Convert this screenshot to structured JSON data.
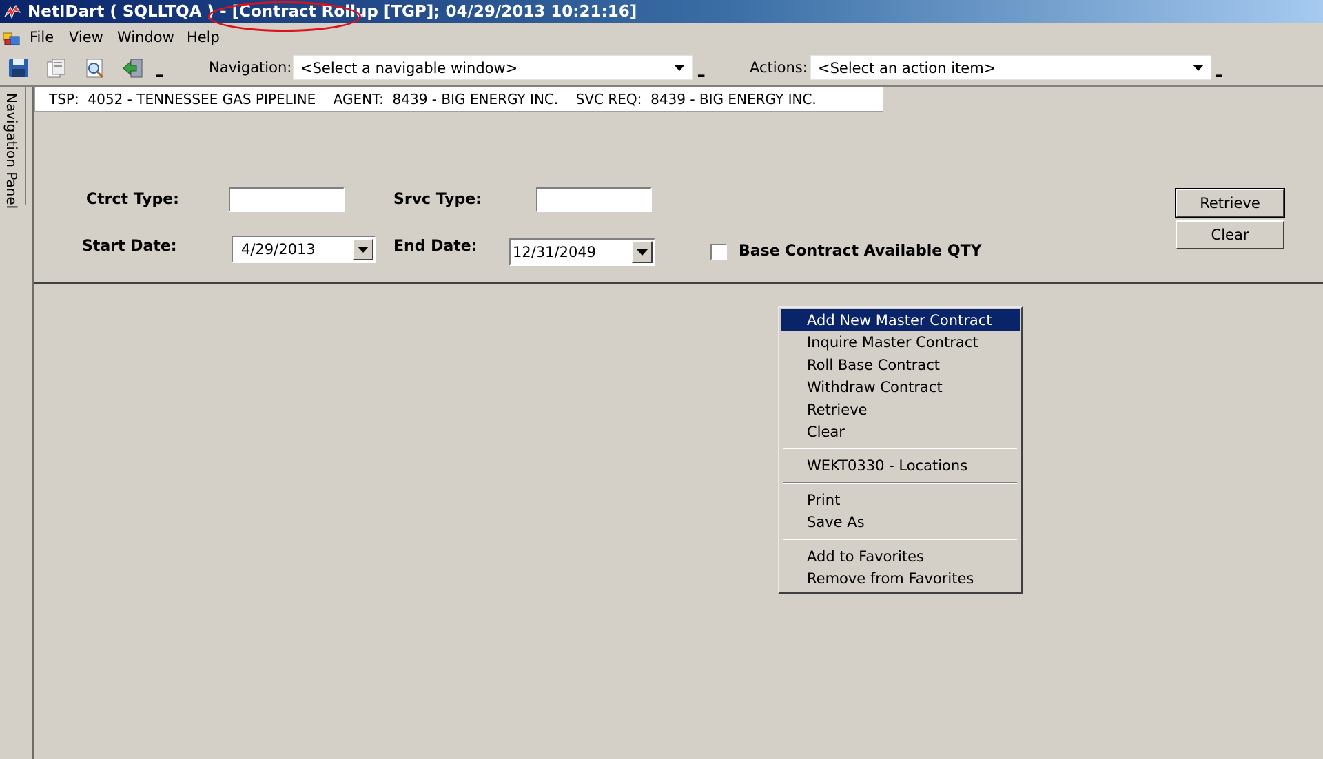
{
  "window": {
    "title": "NetIDart ( SQLLTQA ) - [Contract Rollup [TGP]; 04/29/2013 10:21:16]",
    "app_icon": "netidart-app-icon",
    "annotation_color": "#e0101b"
  },
  "menubar": {
    "items": [
      "File",
      "View",
      "Window",
      "Help"
    ]
  },
  "toolbar": {
    "icons": [
      "save-icon",
      "copy-icon",
      "print-preview-icon",
      "exit-icon"
    ],
    "navigation_label": "Navigation:",
    "navigation_value": "<Select a navigable window>",
    "actions_label": "Actions:",
    "actions_value": "<Select an action item>"
  },
  "nav_panel": {
    "label": "Navigation Panel"
  },
  "infobar": {
    "text": "TSP:  4052 - TENNESSEE GAS PIPELINE    AGENT:  8439 - BIG ENERGY INC.    SVC REQ:  8439 - BIG ENERGY INC."
  },
  "form": {
    "ctrct_type_label": "Ctrct Type:",
    "ctrct_type_value": "",
    "srvc_type_label": "Srvc Type:",
    "srvc_type_value": "",
    "start_date_label": "Start Date:",
    "start_date_value": "4/29/2013",
    "end_date_label": "End Date:",
    "end_date_value": "12/31/2049",
    "base_contract_label": "Base Contract Available QTY",
    "base_contract_checked": false,
    "retrieve_label": "Retrieve",
    "clear_label": "Clear"
  },
  "context_menu": {
    "groups": [
      [
        "Add New Master Contract",
        "Inquire Master Contract",
        "Roll Base Contract",
        "Withdraw Contract",
        "Retrieve",
        "Clear"
      ],
      [
        "WEKT0330 - Locations"
      ],
      [
        "Print",
        "Save As"
      ],
      [
        "Add to Favorites",
        "Remove from Favorites"
      ]
    ],
    "selected": "Add New Master Contract",
    "selected_color": "#0a246a"
  }
}
